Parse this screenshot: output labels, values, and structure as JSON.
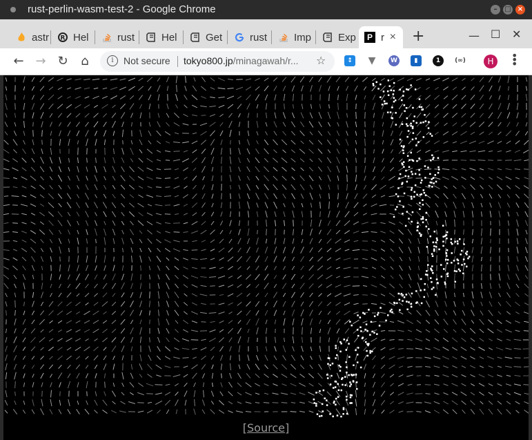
{
  "window": {
    "title": "rust-perlin-wasm-test-2 - Google Chrome"
  },
  "tabs": [
    {
      "label": "astr",
      "favicon": "flame-icon",
      "color": "#f9a825"
    },
    {
      "label": "Hel",
      "favicon": "rust-logo-icon",
      "color": "#222222"
    },
    {
      "label": "rust",
      "favicon": "stackoverflow-icon",
      "color": "#f48024"
    },
    {
      "label": "Hel",
      "favicon": "book-icon",
      "color": "#333333"
    },
    {
      "label": "Get",
      "favicon": "book-icon",
      "color": "#333333"
    },
    {
      "label": "rust",
      "favicon": "google-icon",
      "color": "#4285f4"
    },
    {
      "label": "Imp",
      "favicon": "stackoverflow-icon",
      "color": "#f48024"
    },
    {
      "label": "Exp",
      "favicon": "book-icon",
      "color": "#333333"
    },
    {
      "label": "r",
      "favicon": "p-square-icon",
      "color": "#000000",
      "active": true
    }
  ],
  "new_tab_label": "+",
  "toolbar": {
    "security_label": "Not secure",
    "url_host": "tokyo800.jp",
    "url_path": "/minagawah/r..."
  },
  "profile_initial": "H",
  "content": {
    "source_link": "[Source]"
  },
  "colors": {
    "accent": "#e95420",
    "profile": "#c2185b",
    "background": "#000000"
  }
}
